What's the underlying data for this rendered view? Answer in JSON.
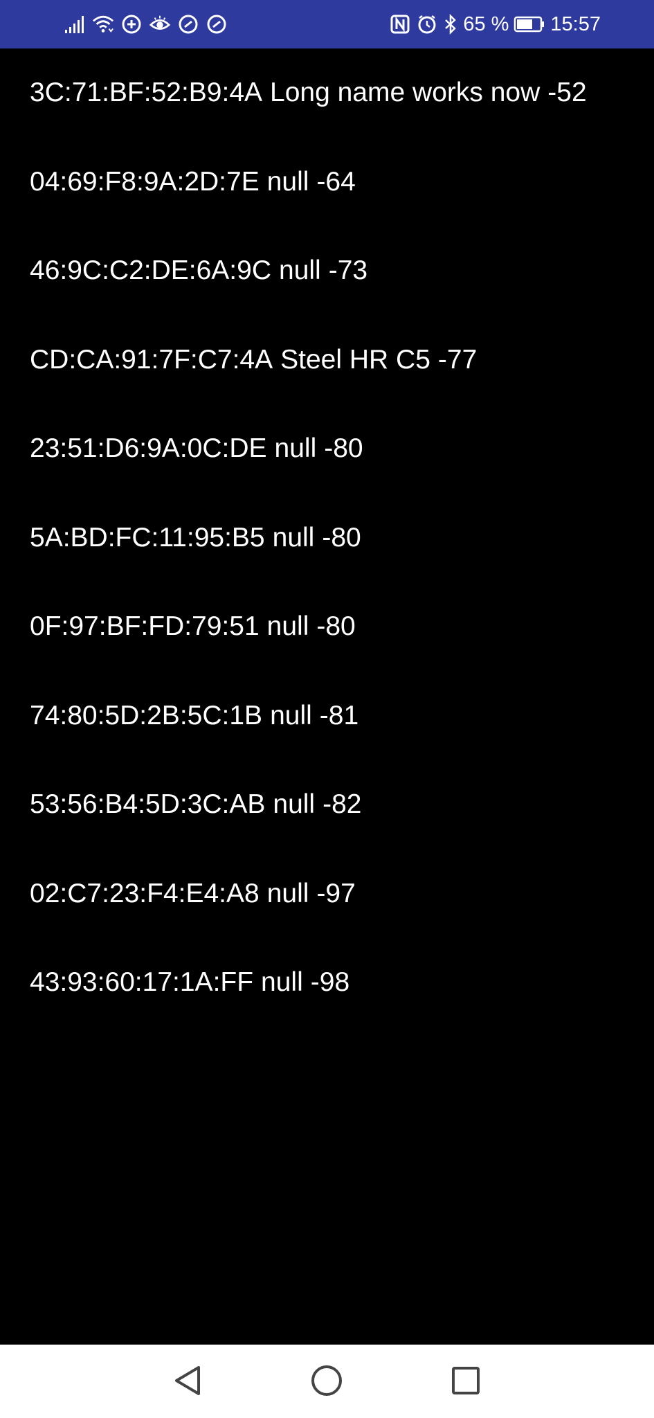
{
  "status_bar": {
    "battery_level": "65 %",
    "time": "15:57",
    "background_color": "#2f3a9e",
    "left_icons": [
      "signal-icon",
      "wifi-icon",
      "data-saver-icon",
      "eye-comfort-icon",
      "link-icon",
      "link-icon"
    ],
    "right_icons": [
      "nfc-icon",
      "alarm-icon",
      "bluetooth-icon",
      "battery-icon"
    ]
  },
  "devices": [
    {
      "address": "3C:71:BF:52:B9:4A",
      "name": "Long name works now",
      "rssi": "-52"
    },
    {
      "address": "04:69:F8:9A:2D:7E",
      "name": "null",
      "rssi": "-64"
    },
    {
      "address": "46:9C:C2:DE:6A:9C",
      "name": "null",
      "rssi": "-73"
    },
    {
      "address": "CD:CA:91:7F:C7:4A",
      "name": "Steel HR C5",
      "rssi": "-77"
    },
    {
      "address": "23:51:D6:9A:0C:DE",
      "name": "null",
      "rssi": "-80"
    },
    {
      "address": "5A:BD:FC:11:95:B5",
      "name": "null",
      "rssi": "-80"
    },
    {
      "address": "0F:97:BF:FD:79:51",
      "name": "null",
      "rssi": "-80"
    },
    {
      "address": "74:80:5D:2B:5C:1B",
      "name": "null",
      "rssi": "-81"
    },
    {
      "address": "53:56:B4:5D:3C:AB",
      "name": "null",
      "rssi": "-82"
    },
    {
      "address": "02:C7:23:F4:E4:A8",
      "name": "null",
      "rssi": "-97"
    },
    {
      "address": "43:93:60:17:1A:FF",
      "name": "null",
      "rssi": "-98"
    }
  ],
  "nav_bar": {
    "buttons": [
      "back-icon",
      "home-icon",
      "recent-apps-icon"
    ]
  }
}
